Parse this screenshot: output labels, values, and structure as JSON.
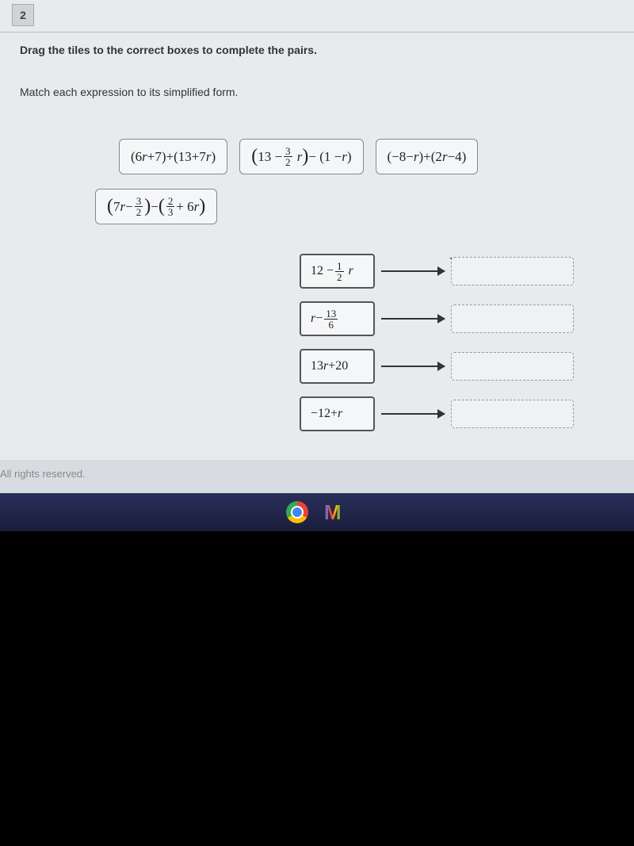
{
  "question": {
    "number": "2",
    "instruction": "Drag the tiles to the correct boxes to complete the pairs.",
    "sub_instruction": "Match each expression to its simplified form."
  },
  "tiles": {
    "tile1_part1": "(6",
    "tile1_var1": "r",
    "tile1_part2": "+7)+(13+7",
    "tile1_var2": "r",
    "tile1_part3": ")",
    "tile2_part1": "13 − ",
    "tile2_frac_num": "3",
    "tile2_frac_den": "2",
    "tile2_var1": "r",
    "tile2_part2": " − (1 − ",
    "tile2_var2": "r",
    "tile2_part3": ")",
    "tile3_part1": "(−8−",
    "tile3_var1": "r",
    "tile3_part2": ")+(2",
    "tile3_var2": "r",
    "tile3_part3": "−4)",
    "tile4_part1": "7",
    "tile4_var1": "r",
    "tile4_part2": " − ",
    "tile4_frac1_num": "3",
    "tile4_frac1_den": "2",
    "tile4_part3": " − ",
    "tile4_frac2_num": "2",
    "tile4_frac2_den": "3",
    "tile4_part4": " + 6",
    "tile4_var2": "r"
  },
  "answers": {
    "ans1_part1": "12 − ",
    "ans1_frac_num": "1",
    "ans1_frac_den": "2",
    "ans1_var": "r",
    "ans2_var": "r",
    "ans2_part1": " − ",
    "ans2_frac_num": "13",
    "ans2_frac_den": "6",
    "ans3_part1": "13",
    "ans3_var": "r",
    "ans3_part2": "+20",
    "ans4_part1": "−12+",
    "ans4_var": "r"
  },
  "footer": "All rights reserved."
}
